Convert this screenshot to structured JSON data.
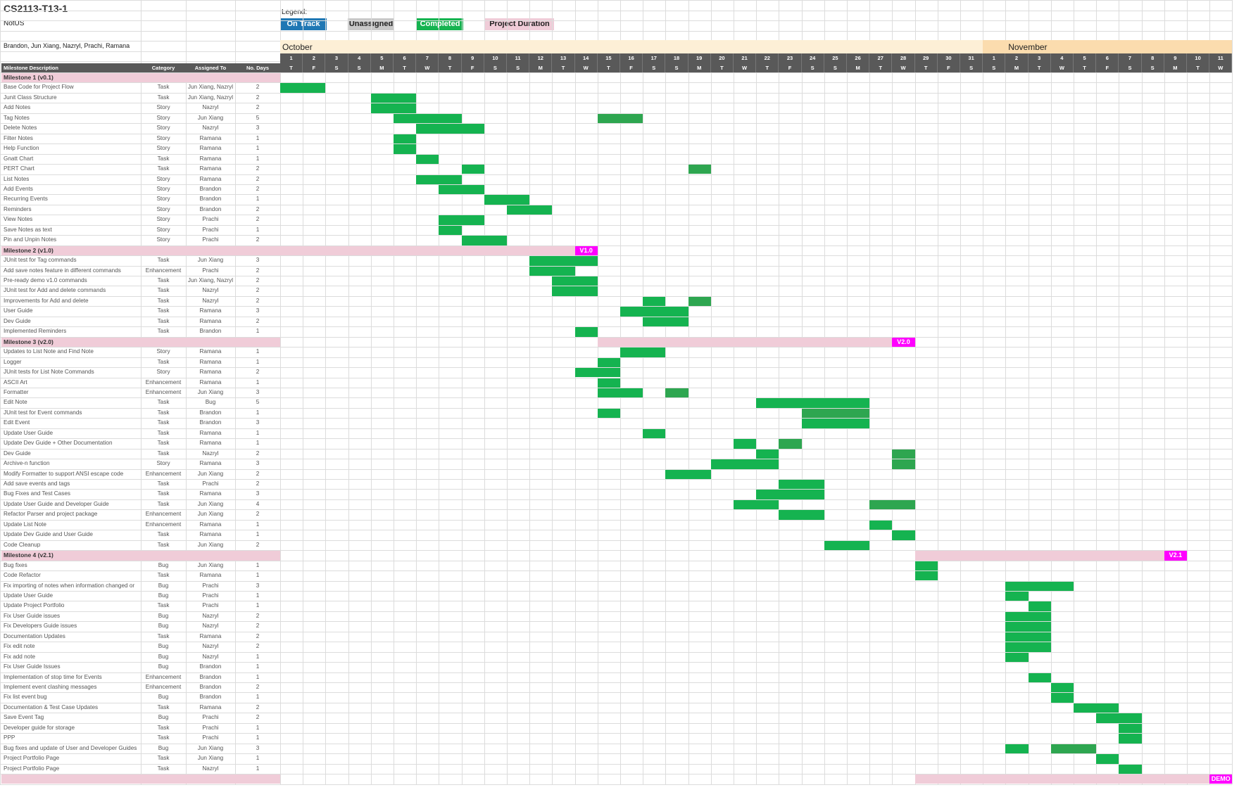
{
  "title": "CS2113-T13-1",
  "subtitle": "NotUS",
  "members": "Brandon, Jun Xiang, Nazryl, Prachi, Ramana",
  "legend": {
    "label": "Legend:",
    "items": [
      {
        "label": "On Track",
        "color": "#1f77b4",
        "text_color": "#ffffff"
      },
      {
        "label": "Unassigned",
        "color": "#c8c8c8",
        "text_color": "#222222"
      },
      {
        "label": "Completed",
        "color": "#15b350",
        "text_color": "#ffffff"
      },
      {
        "label": "Project Duration",
        "color": "#f0ccd8",
        "text_color": "#222222"
      }
    ]
  },
  "months": [
    "October",
    "November"
  ],
  "columns": [
    "Milestone Description",
    "Category",
    "Assigned To",
    "No. Days"
  ],
  "days": [
    "1",
    "2",
    "3",
    "4",
    "5",
    "6",
    "7",
    "8",
    "9",
    "10",
    "11",
    "12",
    "13",
    "14",
    "15",
    "16",
    "17",
    "18",
    "19",
    "20",
    "21",
    "22",
    "23",
    "24",
    "25",
    "26",
    "27",
    "28",
    "29",
    "30",
    "31",
    "1",
    "2",
    "3",
    "4",
    "5",
    "6",
    "7",
    "8",
    "9",
    "10",
    "11"
  ],
  "weekdays": [
    "T",
    "F",
    "S",
    "S",
    "M",
    "T",
    "W",
    "T",
    "F",
    "S",
    "S",
    "M",
    "T",
    "W",
    "T",
    "F",
    "S",
    "S",
    "M",
    "T",
    "W",
    "T",
    "F",
    "S",
    "S",
    "M",
    "T",
    "W",
    "T",
    "F",
    "S",
    "S",
    "M",
    "T",
    "W",
    "T",
    "F",
    "S",
    "S",
    "M",
    "T",
    "W"
  ],
  "colors": {
    "completed": "#15b350",
    "completed_dark": "#2ea650",
    "duration": "#f0ccd8",
    "version": "#ff00ff",
    "header": "#595959",
    "month_band": "#fdefd6",
    "month_band_nov": "#fbdcae"
  },
  "rows": [
    {
      "type": "milestone",
      "desc": "Milestone 1 (v0.1)"
    },
    {
      "desc": "Base Code for Project Flow",
      "cat": "Task",
      "who": "Jun Xiang, Nazryl",
      "days": "2",
      "bars": [
        [
          0,
          1
        ]
      ]
    },
    {
      "desc": "Junit Class Structure",
      "cat": "Task",
      "who": "Jun Xiang, Nazryl",
      "days": "2",
      "bars": [
        [
          4,
          5
        ]
      ]
    },
    {
      "desc": "Add Notes",
      "cat": "Story",
      "who": "Nazryl",
      "days": "2",
      "bars": [
        [
          4,
          5
        ]
      ]
    },
    {
      "desc": "Tag Notes",
      "cat": "Story",
      "who": "Jun Xiang",
      "days": "5",
      "bars": [
        [
          5,
          7
        ],
        [
          14,
          15
        ]
      ]
    },
    {
      "desc": "Delete Notes",
      "cat": "Story",
      "who": "Nazryl",
      "days": "3",
      "bars": [
        [
          6,
          8
        ]
      ]
    },
    {
      "desc": "Filter Notes",
      "cat": "Story",
      "who": "Ramana",
      "days": "1",
      "bars": [
        [
          5,
          5
        ]
      ]
    },
    {
      "desc": "Help Function",
      "cat": "Story",
      "who": "Ramana",
      "days": "1",
      "bars": [
        [
          5,
          5
        ]
      ]
    },
    {
      "desc": "Gnatt Chart",
      "cat": "Task",
      "who": "Ramana",
      "days": "1",
      "bars": [
        [
          6,
          6
        ]
      ]
    },
    {
      "desc": "PERT Chart",
      "cat": "Task",
      "who": "Ramana",
      "days": "2",
      "bars": [
        [
          8,
          8
        ],
        [
          18,
          18
        ]
      ]
    },
    {
      "desc": "List Notes",
      "cat": "Story",
      "who": "Ramana",
      "days": "2",
      "bars": [
        [
          6,
          7
        ]
      ]
    },
    {
      "desc": "Add Events",
      "cat": "Story",
      "who": "Brandon",
      "days": "2",
      "bars": [
        [
          7,
          8
        ]
      ]
    },
    {
      "desc": "Recurring Events",
      "cat": "Story",
      "who": "Brandon",
      "days": "1",
      "bars": [
        [
          9,
          10
        ]
      ]
    },
    {
      "desc": "Reminders",
      "cat": "Story",
      "who": "Brandon",
      "days": "2",
      "bars": [
        [
          10,
          11
        ]
      ]
    },
    {
      "desc": "View Notes",
      "cat": "Story",
      "who": "Prachi",
      "days": "2",
      "bars": [
        [
          7,
          8
        ]
      ]
    },
    {
      "desc": "Save Notes as text",
      "cat": "Story",
      "who": "Prachi",
      "days": "1",
      "bars": [
        [
          7,
          7
        ]
      ]
    },
    {
      "desc": "Pin and Unpin Notes",
      "cat": "Story",
      "who": "Prachi",
      "days": "2",
      "bars": [
        [
          8,
          9
        ]
      ]
    },
    {
      "type": "milestone",
      "desc": "Milestone 2 (v1.0)",
      "span": [
        0,
        12
      ],
      "version": "V1.0",
      "vcol": 13
    },
    {
      "desc": "JUnit test for Tag commands",
      "cat": "Task",
      "who": "Jun Xiang",
      "days": "3",
      "bars": [
        [
          11,
          13
        ]
      ]
    },
    {
      "desc": "Add save notes feature in different commands",
      "cat": "Enhancement",
      "who": "Prachi",
      "days": "2",
      "bars": [
        [
          11,
          12
        ]
      ]
    },
    {
      "desc": "Pre-ready demo v1.0 commands",
      "cat": "Task",
      "who": "Jun Xiang, Nazryl",
      "days": "2",
      "bars": [
        [
          12,
          13
        ]
      ]
    },
    {
      "desc": "JUnit test for Add and delete commands",
      "cat": "Task",
      "who": "Nazryl",
      "days": "2",
      "bars": [
        [
          12,
          13
        ]
      ]
    },
    {
      "desc": "Improvements for Add and delete",
      "cat": "Task",
      "who": "Nazryl",
      "days": "2",
      "bars": [
        [
          16,
          16
        ],
        [
          18,
          18
        ]
      ]
    },
    {
      "desc": "User Guide",
      "cat": "Task",
      "who": "Ramana",
      "days": "3",
      "bars": [
        [
          15,
          17
        ]
      ]
    },
    {
      "desc": "Dev Guide",
      "cat": "Task",
      "who": "Ramana",
      "days": "2",
      "bars": [
        [
          16,
          17
        ]
      ]
    },
    {
      "desc": "Implemented Reminders",
      "cat": "Task",
      "who": "Brandon",
      "days": "1",
      "bars": [
        [
          13,
          13
        ]
      ]
    },
    {
      "type": "milestone",
      "desc": "Milestone 3 (v2.0)",
      "span": [
        14,
        26
      ],
      "version": "V2.0",
      "vcol": 27
    },
    {
      "desc": "Updates to List Note and Find Note",
      "cat": "Story",
      "who": "Ramana",
      "days": "1",
      "bars": [
        [
          15,
          16
        ]
      ]
    },
    {
      "desc": "Logger",
      "cat": "Task",
      "who": "Ramana",
      "days": "1",
      "bars": [
        [
          14,
          14
        ]
      ]
    },
    {
      "desc": "JUnit tests for List Note Commands",
      "cat": "Story",
      "who": "Ramana",
      "days": "2",
      "bars": [
        [
          13,
          14
        ]
      ]
    },
    {
      "desc": "ASCII Art",
      "cat": "Enhancement",
      "who": "Ramana",
      "days": "1",
      "bars": [
        [
          14,
          14
        ]
      ]
    },
    {
      "desc": "Formatter",
      "cat": "Enhancement",
      "who": "Jun Xiang",
      "days": "3",
      "bars": [
        [
          14,
          15
        ],
        [
          17,
          17
        ]
      ]
    },
    {
      "desc": "Edit Note",
      "cat": "Task",
      "who": "Bug",
      "days": "5",
      "bars": [
        [
          21,
          25
        ]
      ]
    },
    {
      "desc": "JUnit test for Event commands",
      "cat": "Task",
      "who": "Brandon",
      "days": "1",
      "bars": [
        [
          14,
          14
        ],
        [
          23,
          25
        ]
      ]
    },
    {
      "desc": "Edit Event",
      "cat": "Task",
      "who": "Brandon",
      "days": "3",
      "bars": [
        [
          23,
          25
        ]
      ]
    },
    {
      "desc": "Update User Guide",
      "cat": "Task",
      "who": "Ramana",
      "days": "1",
      "bars": [
        [
          16,
          16
        ]
      ]
    },
    {
      "desc": "Update Dev Guide + Other Documentation",
      "cat": "Task",
      "who": "Ramana",
      "days": "1",
      "bars": [
        [
          20,
          20
        ],
        [
          22,
          22
        ]
      ]
    },
    {
      "desc": "Dev Guide",
      "cat": "Task",
      "who": "Nazryl",
      "days": "2",
      "bars": [
        [
          21,
          21
        ],
        [
          27,
          27
        ]
      ]
    },
    {
      "desc": "Archive-n function",
      "cat": "Story",
      "who": "Ramana",
      "days": "3",
      "bars": [
        [
          19,
          21
        ],
        [
          27,
          27
        ]
      ]
    },
    {
      "desc": "Modify Formatter to support ANSI escape code",
      "cat": "Enhancement",
      "who": "Jun Xiang",
      "days": "2",
      "bars": [
        [
          17,
          18
        ]
      ]
    },
    {
      "desc": "Add save events and tags",
      "cat": "Task",
      "who": "Prachi",
      "days": "2",
      "bars": [
        [
          22,
          23
        ]
      ]
    },
    {
      "desc": "Bug Fixes and Test Cases",
      "cat": "Task",
      "who": "Ramana",
      "days": "3",
      "bars": [
        [
          21,
          23
        ]
      ]
    },
    {
      "desc": "Update User Guide and Developer Guide",
      "cat": "Task",
      "who": "Jun Xiang",
      "days": "4",
      "bars": [
        [
          20,
          21
        ],
        [
          26,
          27
        ]
      ]
    },
    {
      "desc": "Refactor Parser and project package",
      "cat": "Enhancement",
      "who": "Jun Xiang",
      "days": "2",
      "bars": [
        [
          22,
          23
        ]
      ]
    },
    {
      "desc": "Update List Note",
      "cat": "Enhancement",
      "who": "Ramana",
      "days": "1",
      "bars": [
        [
          26,
          26
        ]
      ]
    },
    {
      "desc": "Update Dev Guide and User Guide",
      "cat": "Task",
      "who": "Ramana",
      "days": "1",
      "bars": [
        [
          27,
          27
        ]
      ]
    },
    {
      "desc": "Code Cleanup",
      "cat": "Task",
      "who": "Jun Xiang",
      "days": "2",
      "bars": [
        [
          24,
          25
        ]
      ]
    },
    {
      "type": "milestone",
      "desc": "Milestone 4 (v2.1)",
      "span": [
        28,
        38
      ],
      "version": "V2.1",
      "vcol": 39
    },
    {
      "desc": "Bug fixes",
      "cat": "Bug",
      "who": "Jun Xiang",
      "days": "1",
      "bars": [
        [
          28,
          28
        ]
      ]
    },
    {
      "desc": "Code Refactor",
      "cat": "Task",
      "who": "Ramana",
      "days": "1",
      "bars": [
        [
          28,
          28
        ]
      ]
    },
    {
      "desc": "Fix importing of notes when information changed or",
      "cat": "Bug",
      "who": "Prachi",
      "days": "3",
      "bars": [
        [
          32,
          34
        ]
      ]
    },
    {
      "desc": "Update User Guide",
      "cat": "Bug",
      "who": "Prachi",
      "days": "1",
      "bars": [
        [
          32,
          32
        ]
      ]
    },
    {
      "desc": "Update Project Portfolio",
      "cat": "Task",
      "who": "Prachi",
      "days": "1",
      "bars": [
        [
          33,
          33
        ]
      ]
    },
    {
      "desc": "Fix User Guide issues",
      "cat": "Bug",
      "who": "Nazryl",
      "days": "2",
      "bars": [
        [
          32,
          33
        ]
      ]
    },
    {
      "desc": "Fix Developers Guide issues",
      "cat": "Bug",
      "who": "Nazryl",
      "days": "2",
      "bars": [
        [
          32,
          33
        ]
      ]
    },
    {
      "desc": "Documentation Updates",
      "cat": "Task",
      "who": "Ramana",
      "days": "2",
      "bars": [
        [
          32,
          33
        ]
      ]
    },
    {
      "desc": "Fix edit note",
      "cat": "Bug",
      "who": "Nazryl",
      "days": "2",
      "bars": [
        [
          32,
          33
        ]
      ]
    },
    {
      "desc": "Fix add note",
      "cat": "Bug",
      "who": "Nazryl",
      "days": "1",
      "bars": [
        [
          32,
          32
        ]
      ]
    },
    {
      "desc": "Fix User Guide Issues",
      "cat": "Bug",
      "who": "Brandon",
      "days": "1",
      "bars": []
    },
    {
      "desc": "Implementation of stop time for Events",
      "cat": "Enhancement",
      "who": "Brandon",
      "days": "1",
      "bars": [
        [
          33,
          33
        ]
      ]
    },
    {
      "desc": "Implement event clashing messages",
      "cat": "Enhancement",
      "who": "Brandon",
      "days": "2",
      "bars": [
        [
          34,
          34
        ]
      ]
    },
    {
      "desc": "Fix list event bug",
      "cat": "Bug",
      "who": "Brandon",
      "days": "1",
      "bars": [
        [
          34,
          34
        ]
      ]
    },
    {
      "desc": "Documentation & Test Case Updates",
      "cat": "Task",
      "who": "Ramana",
      "days": "2",
      "bars": [
        [
          35,
          36
        ]
      ]
    },
    {
      "desc": "Save Event Tag",
      "cat": "Bug",
      "who": "Prachi",
      "days": "2",
      "bars": [
        [
          36,
          37
        ]
      ]
    },
    {
      "desc": "Developer guide for storage",
      "cat": "Task",
      "who": "Prachi",
      "days": "1",
      "bars": [
        [
          37,
          37
        ]
      ]
    },
    {
      "desc": "PPP",
      "cat": "Task",
      "who": "Prachi",
      "days": "1",
      "bars": [
        [
          37,
          37
        ]
      ]
    },
    {
      "desc": "Bug fixes and update of User and Developer Guides",
      "cat": "Bug",
      "who": "Jun Xiang",
      "days": "3",
      "bars": [
        [
          32,
          32
        ],
        [
          34,
          35
        ]
      ]
    },
    {
      "desc": "Project Portfolio Page",
      "cat": "Task",
      "who": "Jun Xiang",
      "days": "1",
      "bars": [
        [
          36,
          36
        ]
      ]
    },
    {
      "desc": "Project Portfolio Page",
      "cat": "Task",
      "who": "Nazryl",
      "days": "1",
      "bars": [
        [
          37,
          37
        ]
      ]
    },
    {
      "type": "milestone",
      "desc": "",
      "span": [
        28,
        40
      ],
      "version": "DEMO",
      "vcol": 41
    }
  ]
}
